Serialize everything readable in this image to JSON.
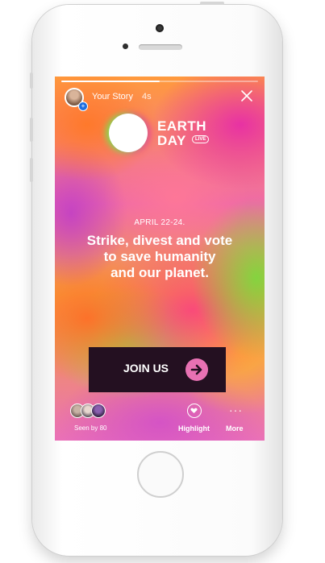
{
  "story": {
    "user_label": "Your Story",
    "time": "4s",
    "progress": 0.5
  },
  "brand": {
    "line1": "EARTH",
    "line2": "DAY",
    "badge": "LIVE"
  },
  "content": {
    "date": "APRIL 22-24.",
    "headline_lines": [
      "Strike, divest and vote",
      "to save humanity",
      "and our planet."
    ]
  },
  "cta": {
    "label": "JOIN US",
    "icon": "arrow-right-icon",
    "accent": "#e871b3",
    "background": "#241021"
  },
  "footer": {
    "seen_by": "Seen by 80",
    "highlight_label": "Highlight",
    "more_label": "More"
  },
  "icons": {
    "close": "close-icon",
    "highlight": "heart-icon",
    "more": "more-dots-icon"
  }
}
